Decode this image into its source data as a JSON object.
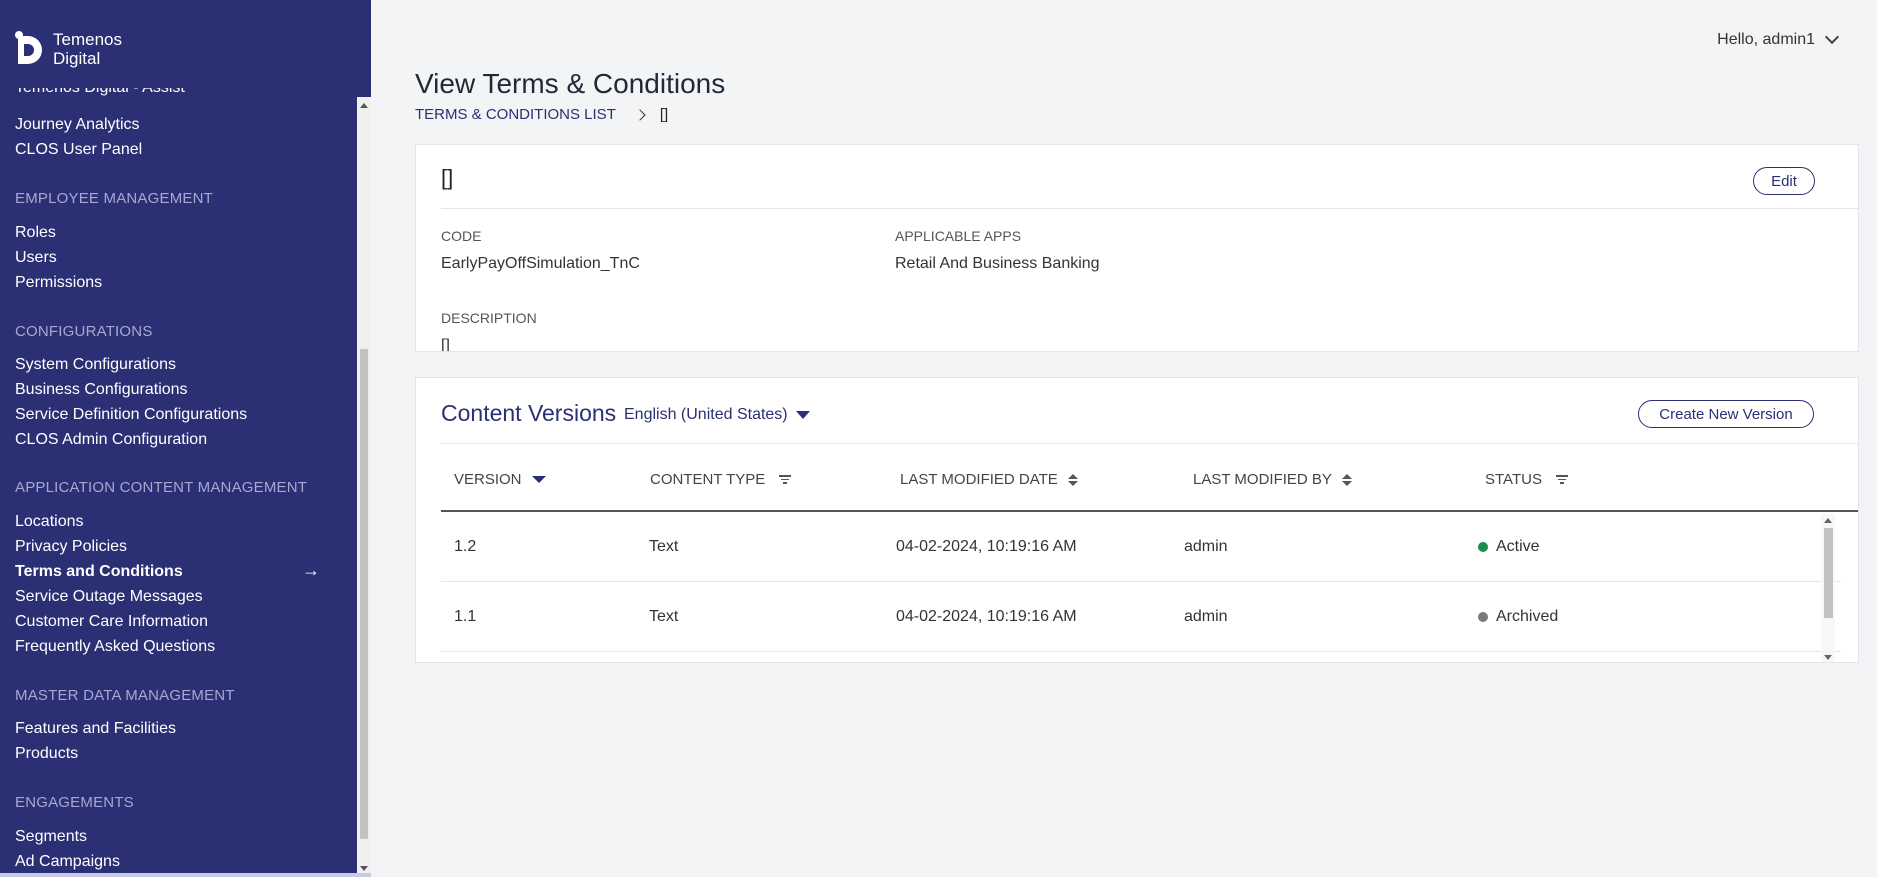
{
  "brand": {
    "line1": "Temenos",
    "line2": "Digital"
  },
  "user_menu": {
    "greeting": "Hello, admin1"
  },
  "sidebar": {
    "items_top": [
      "Temenos Digital - Assist",
      "Journey Analytics",
      "CLOS User Panel"
    ],
    "sections": [
      {
        "title": "EMPLOYEE MANAGEMENT",
        "items": [
          "Roles",
          "Users",
          "Permissions"
        ]
      },
      {
        "title": "CONFIGURATIONS",
        "items": [
          "System Configurations",
          "Business Configurations",
          "Service Definition Configurations",
          "CLOS Admin Configuration"
        ]
      },
      {
        "title": "APPLICATION CONTENT MANAGEMENT",
        "items": [
          "Locations",
          "Privacy Policies",
          "Terms and Conditions",
          "Service Outage Messages",
          "Customer Care Information",
          "Frequently Asked Questions"
        ]
      },
      {
        "title": "MASTER DATA MANAGEMENT",
        "items": [
          "Features and Facilities",
          "Products"
        ]
      },
      {
        "title": "ENGAGEMENTS",
        "items": [
          "Segments",
          "Ad Campaigns"
        ]
      }
    ],
    "active_item": "Terms and Conditions"
  },
  "page": {
    "title": "View Terms & Conditions",
    "breadcrumb": {
      "parent": "TERMS & CONDITIONS LIST",
      "current": "[]"
    }
  },
  "details": {
    "title": "[]",
    "edit_label": "Edit",
    "code_label": "CODE",
    "code_value": "EarlyPayOffSimulation_TnC",
    "apps_label": "APPLICABLE APPS",
    "apps_value": "Retail And Business Banking",
    "description_label": "DESCRIPTION",
    "description_value": "[]"
  },
  "versions": {
    "title": "Content Versions",
    "language": "English (United States)",
    "create_label": "Create New Version",
    "columns": [
      "VERSION",
      "CONTENT TYPE",
      "LAST MODIFIED DATE",
      "LAST MODIFIED BY",
      "STATUS"
    ],
    "rows": [
      {
        "version": "1.2",
        "type": "Text",
        "date": "04-02-2024, 10:19:16 AM",
        "by": "admin",
        "status": "Active",
        "status_color": "#1e8a4c"
      },
      {
        "version": "1.1",
        "type": "Text",
        "date": "04-02-2024, 10:19:16 AM",
        "by": "admin",
        "status": "Archived",
        "status_color": "#7a7a7a"
      }
    ]
  }
}
